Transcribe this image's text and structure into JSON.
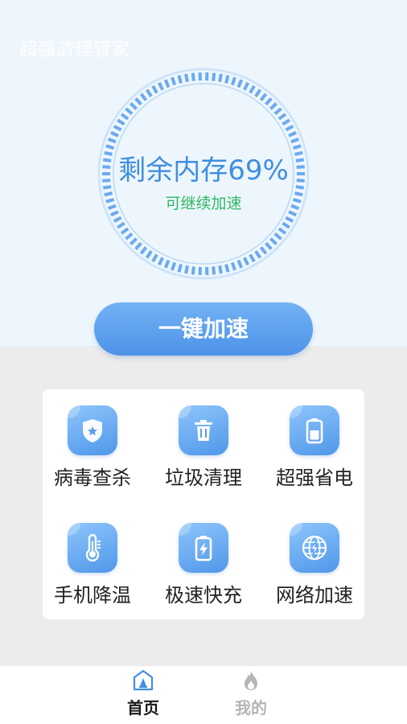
{
  "app": {
    "title": "超强清理管家"
  },
  "gauge": {
    "label": "剩余内存69%",
    "remaining_percent": 69,
    "status": "可继续加速"
  },
  "boost_button": {
    "label": "一键加速"
  },
  "features": [
    {
      "label": "病毒查杀",
      "icon": "shield-star-icon"
    },
    {
      "label": "垃圾清理",
      "icon": "trash-icon"
    },
    {
      "label": "超强省电",
      "icon": "battery-icon"
    },
    {
      "label": "手机降温",
      "icon": "thermometer-icon"
    },
    {
      "label": "极速快充",
      "icon": "charging-battery-icon"
    },
    {
      "label": "网络加速",
      "icon": "globe-bolt-icon"
    }
  ],
  "tabs": [
    {
      "label": "首页",
      "icon": "home-icon",
      "active": true
    },
    {
      "label": "我的",
      "icon": "flame-icon",
      "active": false
    }
  ],
  "colors": {
    "accent": "#4d93e8",
    "status_green": "#2fb766",
    "tab_active": "#1a1a1a",
    "tab_inactive": "#b5b5b5"
  }
}
